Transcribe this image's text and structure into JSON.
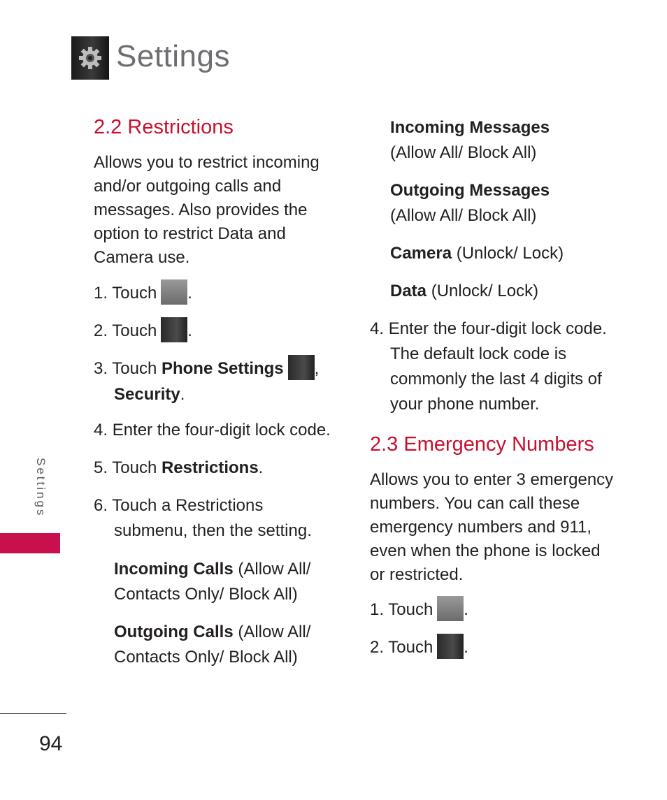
{
  "header": {
    "title": "Settings",
    "icon": "gear-icon"
  },
  "side_tab": {
    "label": "Settings",
    "accent_color": "#c8104c"
  },
  "page_number": "94",
  "colors": {
    "heading": "#c8102e",
    "body": "#231f20",
    "title": "#6d6e71"
  },
  "left": {
    "section_title": "2.2 Restrictions",
    "intro": "Allows you to restrict incoming and/or outgoing calls and messages. Also provides the option to restrict Data and Camera use.",
    "steps": [
      {
        "num": "1.",
        "text": "Touch",
        "icon": "apps-grid-icon",
        "after": "."
      },
      {
        "num": "2.",
        "text": "Touch",
        "icon": "gear-icon",
        "after": "."
      },
      {
        "num": "3.",
        "text": "Touch",
        "bold": "Phone Settings",
        "icon": "phone-settings-icon",
        "after": ",",
        "bold2": "Security",
        "after2": "."
      },
      {
        "num": "4.",
        "text": "Enter the four-digit lock code."
      },
      {
        "num": "5.",
        "text": "Touch",
        "bold": "Restrictions",
        "after": "."
      },
      {
        "num": "6.",
        "text": "Touch a Restrictions submenu, then the setting."
      }
    ],
    "options": [
      {
        "name": "Incoming Calls",
        "values": "(Allow All/ Contacts Only/ Block All)"
      },
      {
        "name": "Outgoing Calls",
        "values": "(Allow All/ Contacts Only/ Block All)"
      }
    ]
  },
  "right": {
    "options": [
      {
        "name": "Incoming Messages",
        "values": "(Allow All/ Block All)"
      },
      {
        "name": "Outgoing Messages",
        "values": "(Allow All/ Block All)"
      },
      {
        "name": "Camera",
        "values": "(Unlock/ Lock)"
      },
      {
        "name": "Data",
        "values": "(Unlock/ Lock)"
      }
    ],
    "step4": {
      "num": "4.",
      "text": "Enter the four-digit lock code. The default lock code is commonly the last 4 digits of your phone number."
    },
    "section_title": "2.3 Emergency Numbers",
    "intro": "Allows you to enter 3 emergency numbers. You can call these emergency numbers and 911, even when the phone is locked or restricted.",
    "steps": [
      {
        "num": "1.",
        "text": "Touch",
        "icon": "apps-grid-icon",
        "after": "."
      },
      {
        "num": "2.",
        "text": "Touch",
        "icon": "gear-icon",
        "after": "."
      }
    ]
  }
}
